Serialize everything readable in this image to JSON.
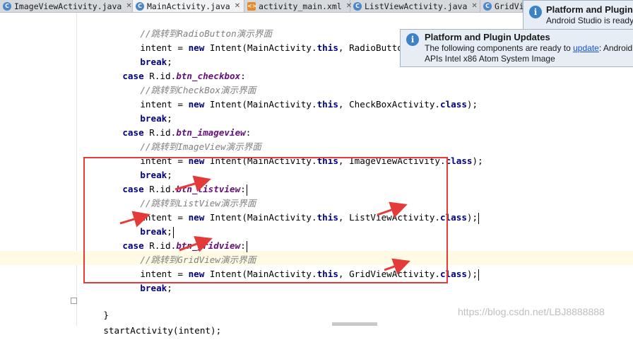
{
  "tabs": [
    {
      "label": "ImageViewActivity.java",
      "type": "java",
      "active": false
    },
    {
      "label": "MainActivity.java",
      "type": "java",
      "active": true
    },
    {
      "label": "activity_main.xml",
      "type": "xml",
      "active": false
    },
    {
      "label": "ListViewActivity.java",
      "type": "java",
      "active": false
    },
    {
      "label": "GridVi",
      "type": "java",
      "active": false
    }
  ],
  "code": {
    "l1": {
      "comment": "//跳转到RadioButton演示界面"
    },
    "l2": {
      "pre": "intent = ",
      "kw1": "new",
      "mid": " Intent(MainActivity.",
      "kw2": "this",
      "post": ", RadioButtonActivity.cl"
    },
    "l3": {
      "kw": "break",
      "post": ";"
    },
    "l4": {
      "kw": "case",
      "mid": " R.id.",
      "field": "btn_checkbox",
      "post": ":"
    },
    "l5": {
      "comment": "//跳转到CheckBox演示界面"
    },
    "l6": {
      "pre": "intent = ",
      "kw1": "new",
      "mid": " Intent(MainActivity.",
      "kw2": "this",
      "mid2": ", CheckBoxActivity.",
      "kw3": "class",
      "post": ");"
    },
    "l7": {
      "kw": "break",
      "post": ";"
    },
    "l8": {
      "kw": "case",
      "mid": " R.id.",
      "field": "btn_imageview",
      "post": ":"
    },
    "l9": {
      "comment": "//跳转到ImageView演示界面"
    },
    "l10": {
      "pre": "intent = ",
      "kw1": "new",
      "mid": " Intent(MainActivity.",
      "kw2": "this",
      "mid2": ", ImageViewActivity.",
      "kw3": "class",
      "post": ");"
    },
    "l11": {
      "kw": "break",
      "post": ";"
    },
    "l12": {
      "kw": "case",
      "mid": " R.id.",
      "field": "btn_listview",
      "post": ":"
    },
    "l13": {
      "comment": "//跳转到ListView演示界面"
    },
    "l14": {
      "pre": "intent = ",
      "kw1": "new",
      "mid": " Intent(MainActivity.",
      "kw2": "this",
      "mid2": ", ListViewActivity.",
      "kw3": "class",
      "post": ");"
    },
    "l15": {
      "kw": "break",
      "post": ";"
    },
    "l16": {
      "kw": "case",
      "mid": " R.id.",
      "field": "btn_gridview",
      "post": ":"
    },
    "l17": {
      "comment": "//跳转到GridView演示界面"
    },
    "l18": {
      "pre": "intent = ",
      "kw1": "new",
      "mid": " Intent(MainActivity.",
      "kw2": "this",
      "mid2": ", GridViewActivity.",
      "kw3": "class",
      "post": ");"
    },
    "l19": {
      "kw": "break",
      "post": ";"
    },
    "l20": {
      "text": "}"
    },
    "l21": {
      "text": "startActivity(intent);"
    }
  },
  "notifications": {
    "back": {
      "title": "Platform and Plugin U",
      "body": "Android Studio is ready t"
    },
    "front": {
      "title": "Platform and Plugin Updates",
      "body_pre": "The following components are ready to ",
      "link": "update",
      "body_post": ": Android",
      "body_line2": "APIs Intel x86 Atom System Image"
    }
  },
  "watermark": "https://blog.csdn.net/LBJ8888888",
  "colors": {
    "keyword": "#000080",
    "comment": "#808080",
    "field": "#660e7a",
    "highlight_box": "#e53a3a",
    "arrow": "#e53a3a"
  },
  "icons": {
    "tab_java": "c-class-icon",
    "tab_xml": "xml-file-icon",
    "notification": "info-icon"
  }
}
